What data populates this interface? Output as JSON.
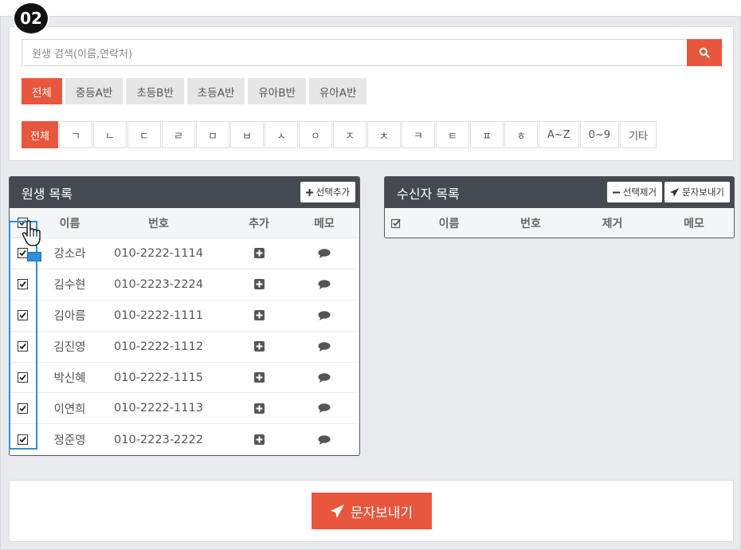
{
  "step_label": "02",
  "search": {
    "placeholder": "원생 검색(이름,연락처)"
  },
  "class_tabs": [
    "전체",
    "중등A반",
    "초등B반",
    "초등A반",
    "유아B반",
    "유아A반"
  ],
  "initial_tabs": [
    "전체",
    "ㄱ",
    "ㄴ",
    "ㄷ",
    "ㄹ",
    "ㅁ",
    "ㅂ",
    "ㅅ",
    "ㅇ",
    "ㅈ",
    "ㅊ",
    "ㅋ",
    "ㅌ",
    "ㅍ",
    "ㅎ",
    "A~Z",
    "0~9",
    "기타"
  ],
  "student_panel": {
    "title": "원생 목록",
    "add_selected_label": "선택추가",
    "columns": {
      "name": "이름",
      "phone": "번호",
      "add": "추가",
      "memo": "메모"
    },
    "rows": [
      {
        "name": "강소라",
        "phone": "010-2222-1114"
      },
      {
        "name": "김수현",
        "phone": "010-2223-2224"
      },
      {
        "name": "김아름",
        "phone": "010-2222-1111"
      },
      {
        "name": "김진영",
        "phone": "010-2222-1112"
      },
      {
        "name": "박신혜",
        "phone": "010-2222-1115"
      },
      {
        "name": "이연희",
        "phone": "010-2222-1113"
      },
      {
        "name": "정준영",
        "phone": "010-2223-2222"
      }
    ]
  },
  "recipient_panel": {
    "title": "수신자 목록",
    "remove_selected_label": "선택제거",
    "send_label": "문자보내기",
    "columns": {
      "name": "이름",
      "phone": "번호",
      "remove": "제거",
      "memo": "메모"
    }
  },
  "send_button_label": "문자보내기",
  "colors": {
    "accent": "#e8563e",
    "header": "#454a51",
    "selection": "#2f8fd8"
  }
}
